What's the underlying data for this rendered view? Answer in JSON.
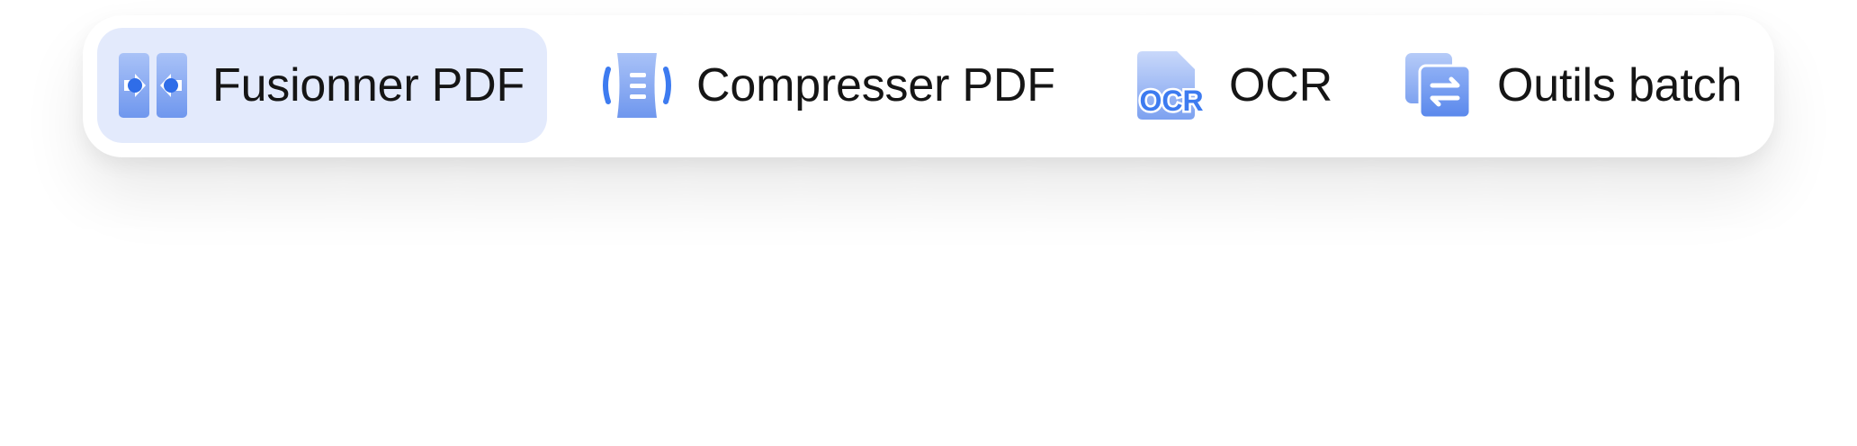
{
  "toolbar": {
    "items": [
      {
        "label": "Fusionner PDF",
        "icon": "merge-pdf-icon",
        "active": true
      },
      {
        "label": "Compresser PDF",
        "icon": "compress-pdf-icon",
        "active": false
      },
      {
        "label": "OCR",
        "icon": "ocr-icon",
        "icon_text": "OCR",
        "active": false
      },
      {
        "label": "Outils batch",
        "icon": "batch-tools-icon",
        "active": false
      }
    ]
  },
  "colors": {
    "active_background": "#e3eafc",
    "accent_blue": "#3d7bf0",
    "light_blue": "#8fb0f5",
    "text": "#151515"
  }
}
